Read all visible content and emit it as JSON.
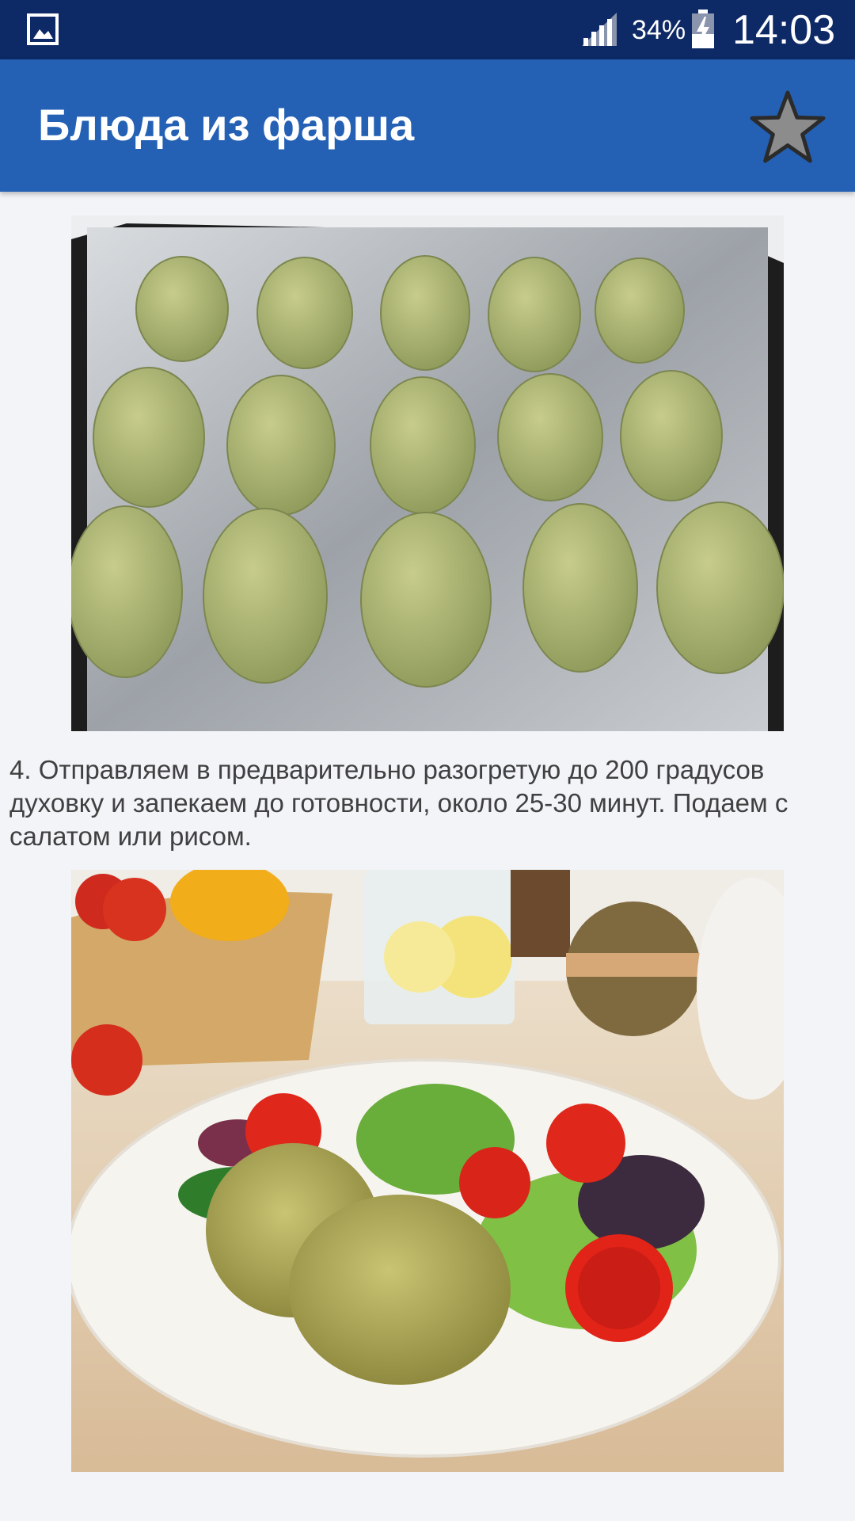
{
  "status_bar": {
    "battery_percent": "34%",
    "time": "14:03",
    "icons": [
      "gallery-icon",
      "signal-icon",
      "battery-charging-icon"
    ]
  },
  "app_bar": {
    "title": "Блюда из фарша",
    "action_icon": "star-icon"
  },
  "content": {
    "step_text": "4. Отправляем в предварительно разогретую до 200 градусов духовку и запекаем до готовности, около 25-30 минут. Подаем с салатом или рисом.",
    "images": [
      "raw-patties-on-baking-tray",
      "cooked-patties-with-salad-plate"
    ]
  },
  "colors": {
    "status_bar": "#0d2966",
    "app_bar": "#2461b5",
    "background": "#f2f4f8"
  }
}
